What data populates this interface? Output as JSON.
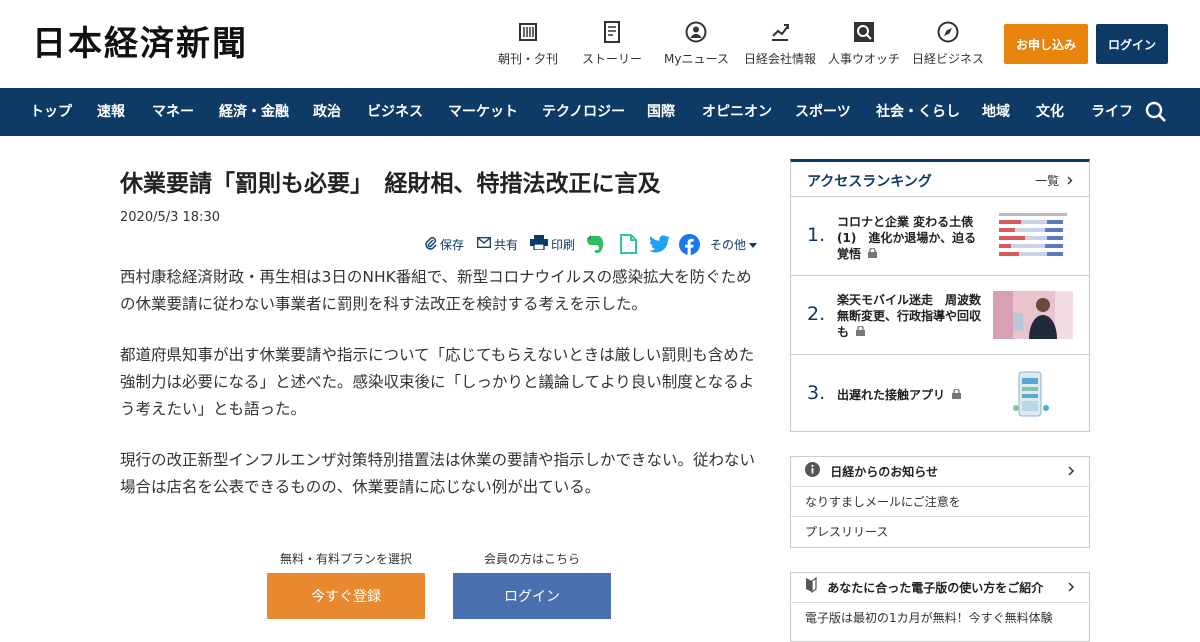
{
  "header": {
    "logo": "日本経済新聞",
    "nav": [
      {
        "label": "朝刊・夕刊",
        "icon": "newspaper-icon"
      },
      {
        "label": "ストーリー",
        "icon": "story-icon"
      },
      {
        "label": "Myニュース",
        "icon": "user-icon"
      },
      {
        "label": "日経会社情報",
        "icon": "chart-icon"
      },
      {
        "label": "人事ウオッチ",
        "icon": "search-person-icon"
      },
      {
        "label": "日経ビジネス",
        "icon": "compass-icon"
      }
    ],
    "apply_label": "お申し込み",
    "login_label": "ログイン"
  },
  "navbar": {
    "items": [
      "トップ",
      "速報",
      "マネー",
      "経済・金融",
      "政治",
      "ビジネス",
      "マーケット",
      "テクノロジー",
      "国際",
      "オピニオン",
      "スポーツ",
      "社会・くらし",
      "地域",
      "文化",
      "ライフ"
    ]
  },
  "article": {
    "title": "休業要請「罰則も必要」　経財相、特措法改正に言及",
    "date": "2020/5/3 18:30",
    "tools": {
      "save": "保存",
      "share": "共有",
      "print": "印刷",
      "more": "その他"
    },
    "paragraphs": [
      "西村康稔経済財政・再生相は3日のNHK番組で、新型コロナウイルスの感染拡大を防ぐための休業要請に従わない事業者に罰則を科す法改正を検討する考えを示した。",
      "都道府県知事が出す休業要請や指示について「応じてもらえないときは厳しい罰則も含めた強制力は必要になる」と述べた。感染収束後に「しっかりと議論してより良い制度となるよう考えたい」とも語った。",
      "現行の改正新型インフルエンザ対策特別措置法は休業の要請や指示しかできない。従わない場合は店名を公表できるものの、休業要請に応じない例が出ている。"
    ]
  },
  "cta": {
    "register_caption": "無料・有料プランを選択",
    "register_label": "今すぐ登録",
    "login_caption": "会員の方はこちら",
    "login_label": "ログイン"
  },
  "ranking": {
    "title": "アクセスランキング",
    "all_label": "一覧",
    "items": [
      {
        "rank": "1.",
        "text": "コロナと企業 変わる土俵(1)　進化か退場か、迫る覚悟"
      },
      {
        "rank": "2.",
        "text": "楽天モバイル迷走　周波数無断変更、行政指導や回収も"
      },
      {
        "rank": "3.",
        "text": "出遅れた接触アプリ"
      }
    ]
  },
  "info": {
    "title": "日経からのお知らせ",
    "items": [
      "なりすましメールにご注意を",
      "プレスリリース"
    ]
  },
  "guide": {
    "title": "あなたに合った電子版の使い方をご紹介",
    "text": "電子版は最初の1カ月が無料！今すぐ無料体験"
  },
  "colors": {
    "navy": "#0e3a66",
    "orange": "#e8840c",
    "cta_orange": "#e8892f",
    "cta_blue": "#4a6fae"
  }
}
